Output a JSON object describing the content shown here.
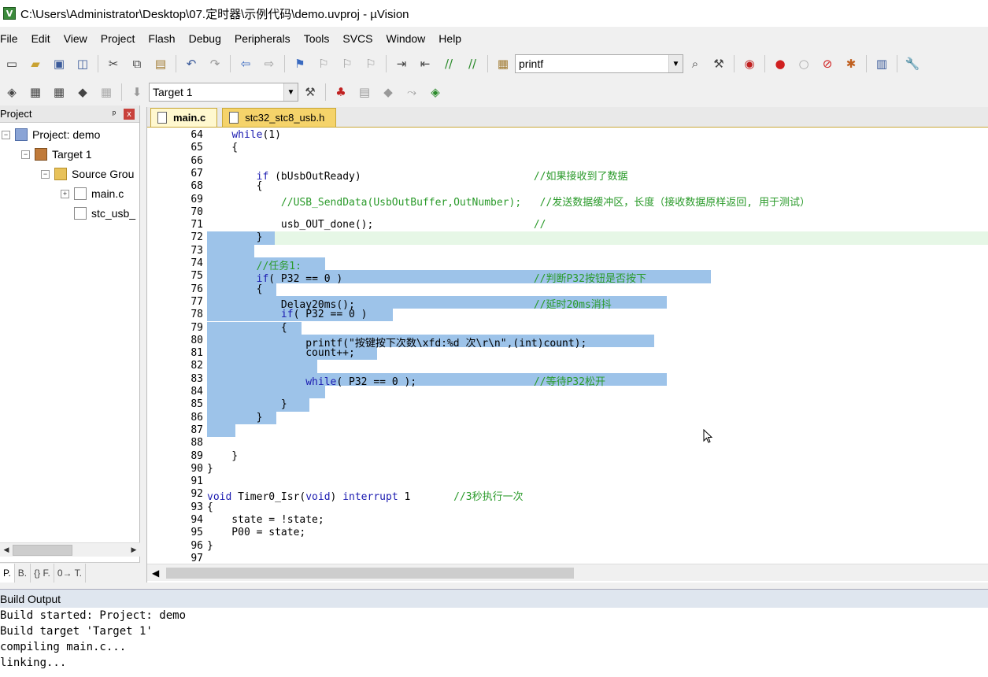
{
  "window": {
    "title": "C:\\Users\\Administrator\\Desktop\\07.定时器\\示例代码\\demo.uvproj - µVision",
    "app_icon": "V"
  },
  "menu": [
    "File",
    "Edit",
    "View",
    "Project",
    "Flash",
    "Debug",
    "Peripherals",
    "Tools",
    "SVCS",
    "Window",
    "Help"
  ],
  "toolbar1": {
    "find_value": "printf"
  },
  "toolbar2": {
    "target_value": "Target 1"
  },
  "project_panel": {
    "title": "Project",
    "pin": "ᵖ",
    "close": "x",
    "tree": [
      {
        "label": "Project: demo",
        "level": 0,
        "icon": "project-icon",
        "expander": "−"
      },
      {
        "label": "Target 1",
        "level": 1,
        "icon": "target-icon",
        "expander": "−"
      },
      {
        "label": "Source Grou",
        "level": 2,
        "icon": "folder-icon",
        "expander": "−"
      },
      {
        "label": "main.c",
        "level": 3,
        "icon": "file-icon",
        "expander": "+"
      },
      {
        "label": "stc_usb_",
        "level": 3,
        "icon": "file-icon",
        "expander": ""
      }
    ],
    "tabs": [
      "P.",
      "B.",
      "{} F.",
      "0→ T."
    ]
  },
  "editor": {
    "tabs": [
      {
        "label": "main.c",
        "active": true
      },
      {
        "label": "stc32_stc8_usb.h",
        "active": false
      }
    ],
    "lines": [
      {
        "n": "64",
        "code": "    while(1)"
      },
      {
        "n": "65",
        "code": "    {"
      },
      {
        "n": "66",
        "code": ""
      },
      {
        "n": "67",
        "code": "        if (bUsbOutReady)                            //如果接收到了数据"
      },
      {
        "n": "68",
        "code": "        {"
      },
      {
        "n": "69",
        "code": "            //USB_SendData(UsbOutBuffer,OutNumber);   //发送数据缓冲区，长度（接收数据原样返回, 用于测试）"
      },
      {
        "n": "70",
        "code": ""
      },
      {
        "n": "71",
        "code": "            usb_OUT_done();                          //"
      },
      {
        "n": "72",
        "code": "        }"
      },
      {
        "n": "73",
        "code": ""
      },
      {
        "n": "74",
        "code": "        //任务1:"
      },
      {
        "n": "75",
        "code": "        if( P32 == 0 )                               //判断P32按钮是否按下"
      },
      {
        "n": "76",
        "code": "        {"
      },
      {
        "n": "77",
        "code": "            Delay20ms();                             //延时20ms消抖"
      },
      {
        "n": "78",
        "code": "            if( P32 == 0 )"
      },
      {
        "n": "79",
        "code": "            {"
      },
      {
        "n": "80",
        "code": "                printf(\"按键按下次数\\xfd:%d 次\\r\\n\",(int)count);"
      },
      {
        "n": "81",
        "code": "                count++;"
      },
      {
        "n": "82",
        "code": ""
      },
      {
        "n": "83",
        "code": "                while( P32 == 0 );                   //等待P32松开"
      },
      {
        "n": "84",
        "code": ""
      },
      {
        "n": "85",
        "code": "            }"
      },
      {
        "n": "86",
        "code": "        }"
      },
      {
        "n": "87",
        "code": ""
      },
      {
        "n": "88",
        "code": ""
      },
      {
        "n": "89",
        "code": "    }"
      },
      {
        "n": "90",
        "code": "}"
      },
      {
        "n": "91",
        "code": ""
      },
      {
        "n": "92",
        "code": "void Timer0_Isr(void) interrupt 1       //3秒执行一次"
      },
      {
        "n": "93",
        "code": "{"
      },
      {
        "n": "94",
        "code": "    state = !state;"
      },
      {
        "n": "95",
        "code": "    P00 = state;"
      },
      {
        "n": "96",
        "code": "}"
      },
      {
        "n": "97",
        "code": ""
      }
    ]
  },
  "build_output": {
    "title": "Build Output",
    "lines": [
      "Build started: Project: demo",
      "Build target 'Target 1'",
      "compiling main.c...",
      "linking..."
    ]
  },
  "colors": {
    "selection": "#9dc3e9",
    "keyword": "#1a1ab0",
    "comment": "#2a9a2a",
    "active_tab": "#fff8cf",
    "inactive_tab": "#f5d36a"
  }
}
